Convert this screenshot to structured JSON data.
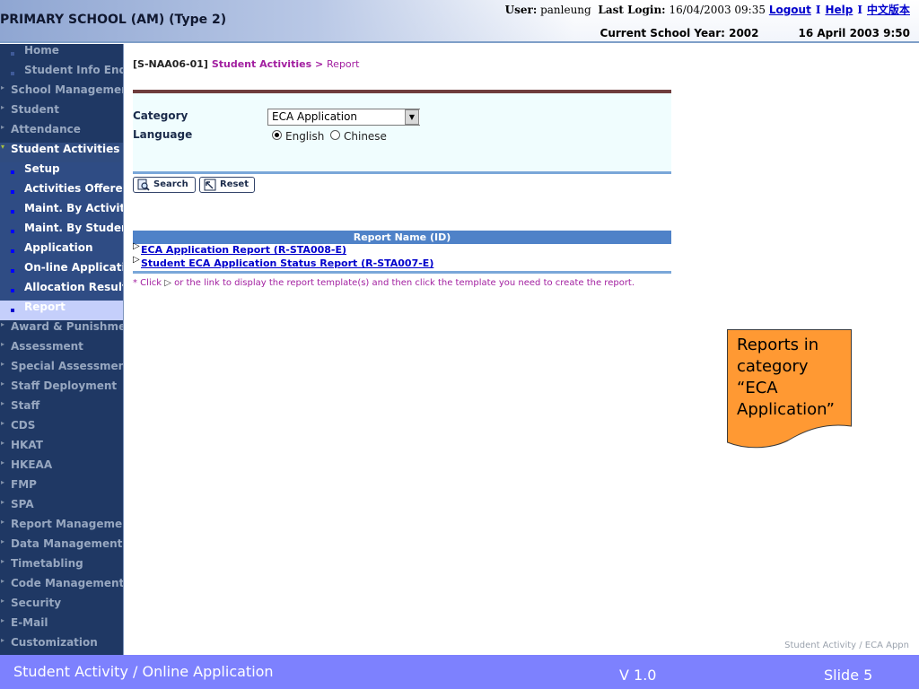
{
  "header": {
    "school_title": "PRIMARY SCHOOL (AM) (Type 2)",
    "user_label": "User:",
    "user_name": "panleung",
    "last_login_label": "Last Login:",
    "last_login_value": "16/04/2003 09:35",
    "logout_link": "Logout",
    "help_link": "Help",
    "language_link": "中文版本",
    "separator": "I",
    "school_year": "Current School Year: 2002",
    "datetime": "16 April 2003 9:50"
  },
  "sidebar": {
    "items": [
      {
        "label": "Home",
        "level": "sub"
      },
      {
        "label": "Student Info Enquiry",
        "level": "sub"
      },
      {
        "label": "School Management",
        "level": "top"
      },
      {
        "label": "Student",
        "level": "top"
      },
      {
        "label": "Attendance",
        "level": "top"
      },
      {
        "label": "Student Activities",
        "level": "top-active"
      },
      {
        "label": "Setup",
        "level": "active-sub"
      },
      {
        "label": "Activities Offered",
        "level": "active-sub"
      },
      {
        "label": "Maint. By Activity",
        "level": "active-sub"
      },
      {
        "label": "Maint. By Student",
        "level": "active-sub"
      },
      {
        "label": "Application",
        "level": "active-sub"
      },
      {
        "label": "On-line Application",
        "level": "active-sub"
      },
      {
        "label": "Allocation Results",
        "level": "active-sub"
      },
      {
        "label": "Report",
        "level": "current"
      },
      {
        "label": "Award & Punishment",
        "level": "top"
      },
      {
        "label": "Assessment",
        "level": "top"
      },
      {
        "label": "Special Assessment",
        "level": "top"
      },
      {
        "label": "Staff Deployment",
        "level": "top"
      },
      {
        "label": "Staff",
        "level": "top"
      },
      {
        "label": "CDS",
        "level": "top"
      },
      {
        "label": "HKAT",
        "level": "top"
      },
      {
        "label": "HKEAA",
        "level": "top"
      },
      {
        "label": "FMP",
        "level": "top"
      },
      {
        "label": "SPA",
        "level": "top"
      },
      {
        "label": "Report Management",
        "level": "top"
      },
      {
        "label": "Data Management",
        "level": "top"
      },
      {
        "label": "Timetabling",
        "level": "top"
      },
      {
        "label": "Code Management",
        "level": "top"
      },
      {
        "label": "Security",
        "level": "top"
      },
      {
        "label": "E-Mail",
        "level": "top"
      },
      {
        "label": "Customization",
        "level": "top"
      }
    ]
  },
  "breadcrumb": {
    "page_id": "[S-NAA06-01]",
    "module": "Student Activities",
    "separator": ">",
    "page": "Report"
  },
  "filter": {
    "category_label": "Category",
    "category_value": "ECA Application",
    "language_label": "Language",
    "language_options": [
      "English",
      "Chinese"
    ],
    "language_selected": "English"
  },
  "buttons": {
    "search": "Search",
    "reset": "Reset"
  },
  "reports": {
    "header": "Report Name (ID)",
    "rows": [
      "ECA Application Report (R-STA008-E)",
      "Student ECA Application Status Report (R-STA007-E)"
    ],
    "footnote_before": "* Click",
    "footnote_after": "or the link to display the report template(s) and then click the template you need to create the report."
  },
  "callout": {
    "text_line1": "Reports in",
    "text_line2": "category",
    "text_line3": "“ECA",
    "text_line4": "Application”",
    "fill_color": "#ff9933"
  },
  "watermark": "Student Activity / ECA Appn",
  "footer": {
    "title": "Student Activity / Online Application",
    "version": "V 1.0",
    "slide": "Slide 5",
    "bg_color": "#7d81fe"
  }
}
